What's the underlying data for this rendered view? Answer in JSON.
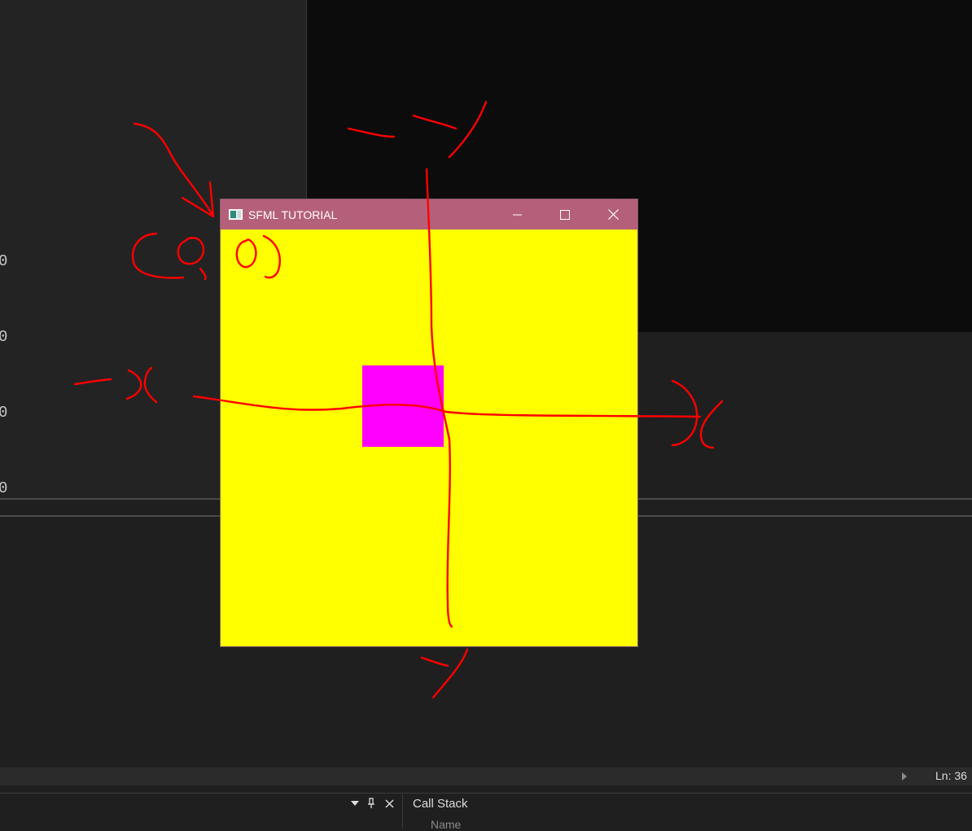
{
  "editor": {
    "gutter_numbers": [
      "0",
      "0",
      "0",
      "0"
    ]
  },
  "sfml_window": {
    "title": "SFML TUTORIAL",
    "titlebar_color": "#b5607a",
    "background_color": "#ffff00",
    "shape_color": "#ff00ff"
  },
  "status_bar": {
    "line_indicator": "Ln: 36"
  },
  "call_stack": {
    "title": "Call Stack",
    "column_name": "Name"
  },
  "annotations": {
    "color": "#ff0000"
  }
}
